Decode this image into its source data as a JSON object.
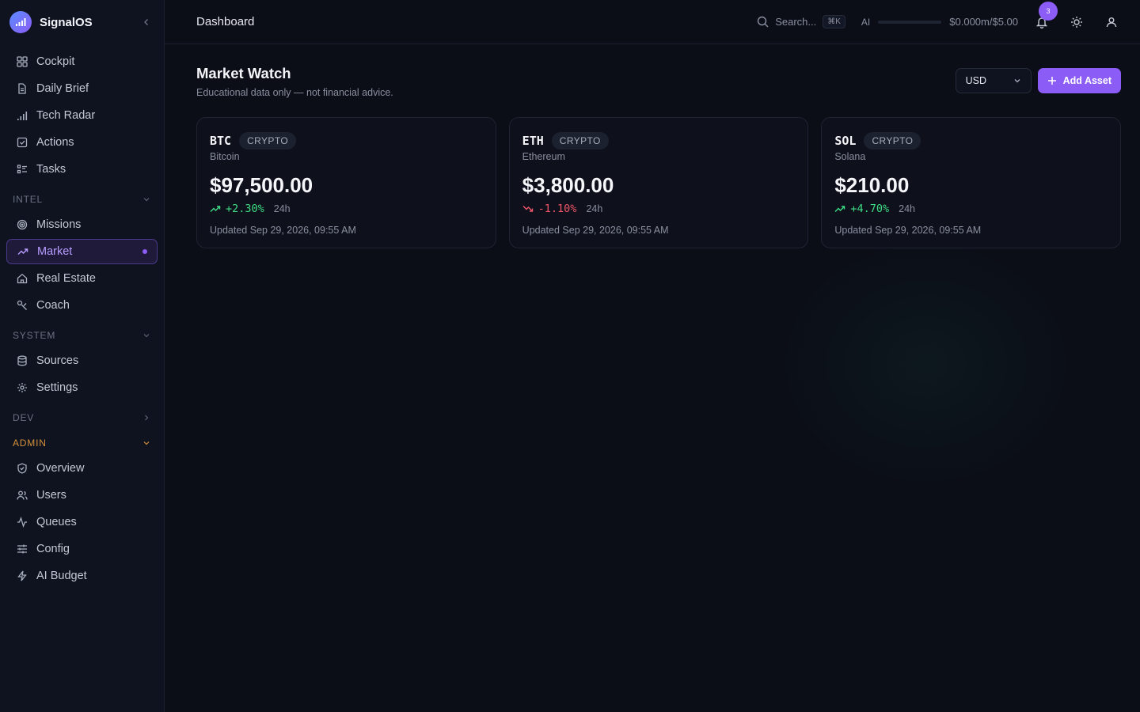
{
  "brand": {
    "name": "SignalOS"
  },
  "sidebar": {
    "top_items": [
      {
        "label": "Cockpit",
        "icon": "grid-icon"
      },
      {
        "label": "Daily Brief",
        "icon": "document-icon"
      },
      {
        "label": "Tech Radar",
        "icon": "signal-bars-icon"
      },
      {
        "label": "Actions",
        "icon": "checkbox-icon"
      },
      {
        "label": "Tasks",
        "icon": "list-checks-icon"
      }
    ],
    "sections": {
      "intel": {
        "title": "INTEL",
        "items": [
          "Missions",
          "Market",
          "Real Estate",
          "Coach"
        ]
      },
      "system": {
        "title": "SYSTEM",
        "items": [
          "Sources",
          "Settings"
        ]
      },
      "dev": {
        "title": "DEV"
      },
      "admin": {
        "title": "ADMIN",
        "items": [
          "Overview",
          "Users",
          "Queues",
          "Config",
          "AI Budget"
        ]
      }
    },
    "active_item": "Market"
  },
  "topbar": {
    "breadcrumb": "Dashboard",
    "search_label": "Search...",
    "search_shortcut": "⌘K",
    "ai_label": "AI",
    "ai_usage_fraction": 0.0,
    "ai_cost": "$0.000m/$5.00",
    "notifications_count": "3"
  },
  "page": {
    "title": "Market Watch",
    "subtitle": "Educational data only — not financial advice.",
    "currency": "USD",
    "add_label": "Add Asset"
  },
  "assets": [
    {
      "ticker": "BTC",
      "type": "CRYPTO",
      "name": "Bitcoin",
      "price": "$97,500.00",
      "change": "+2.30%",
      "direction": "up",
      "period": "24h",
      "updated": "Updated Sep 29, 2026, 09:55 AM"
    },
    {
      "ticker": "ETH",
      "type": "CRYPTO",
      "name": "Ethereum",
      "price": "$3,800.00",
      "change": "-1.10%",
      "direction": "down",
      "period": "24h",
      "updated": "Updated Sep 29, 2026, 09:55 AM"
    },
    {
      "ticker": "SOL",
      "type": "CRYPTO",
      "name": "Solana",
      "price": "$210.00",
      "change": "+4.70%",
      "direction": "up",
      "period": "24h",
      "updated": "Updated Sep 29, 2026, 09:55 AM"
    }
  ],
  "colors": {
    "accent": "#8b5cf6",
    "up": "#3ddc84",
    "down": "#f0556a",
    "admin": "#d4913a"
  }
}
